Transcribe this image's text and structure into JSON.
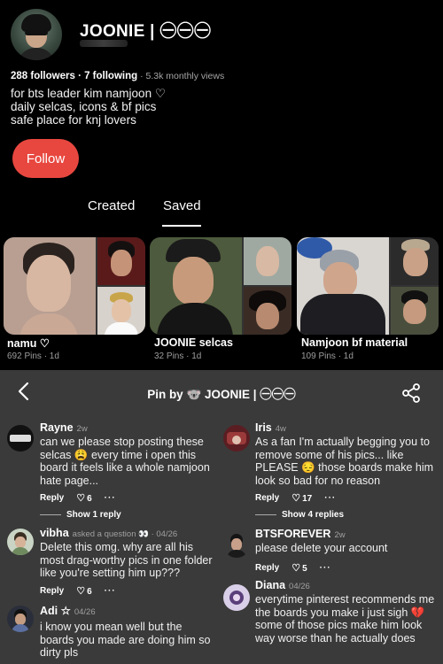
{
  "profile": {
    "display_name": "JOONIE | ㊀㊀㊀",
    "bear_emoji": "🐨",
    "followers": "288 followers",
    "following": " · 7 following",
    "monthly_views": " · 5.3k monthly views",
    "bio_line1": "for bts leader kim namjoon ♡",
    "bio_line2": "daily selcas, icons & bf pics",
    "bio_line3": "safe place for knj lovers",
    "follow_label": "Follow",
    "accent_color": "#e8473f"
  },
  "tabs": [
    {
      "label": "Created"
    },
    {
      "label": "Saved"
    }
  ],
  "boards": [
    {
      "title": "namu ♡",
      "meta": "692 Pins · 1d"
    },
    {
      "title": "JOONIE selcas",
      "meta": "32 Pins · 1d"
    },
    {
      "title": "Namjoon bf material",
      "meta": "109 Pins · 1d"
    }
  ],
  "sheet": {
    "back_icon": "chevron-left-icon",
    "title": "Pin by 🐨 JOONIE | ㊀㊀㊀",
    "share_icon": "share-icon"
  },
  "comments": {
    "left": [
      {
        "author": "Rayne",
        "time": "2w",
        "text": "can we please stop posting these selcas 😩 every time i open this board it feels like a whole namjoon hate page...",
        "reply": "Reply",
        "likes": "6",
        "replies": "Show 1 reply"
      },
      {
        "author": "vibha",
        "time": "asked a question 👀 · 04/26",
        "text": "Delete this omg. why are all his most drag-worthy pics in one folder like you're setting him up???",
        "reply": "Reply",
        "likes": "6"
      },
      {
        "author": "Adi ☆",
        "time": "04/26",
        "text": "i know you mean well but the boards you made are doing him so dirty pls"
      }
    ],
    "right": [
      {
        "author": "Iris",
        "time": "4w",
        "text": "As a fan I'm actually begging you to remove some of his pics... like PLEASE 😔 those boards make him look so bad for no reason",
        "reply": "Reply",
        "likes": "17",
        "replies": "Show 4 replies"
      },
      {
        "author": "BTSFOREVER",
        "time": "2w",
        "text": "please delete your account",
        "reply": "Reply",
        "likes": "5"
      },
      {
        "author": "Diana",
        "time": "04/26",
        "text": "everytime pinterest recommends me the boards you make i just sigh 💔 some of those pics make him look way worse than he actually does"
      }
    ]
  }
}
